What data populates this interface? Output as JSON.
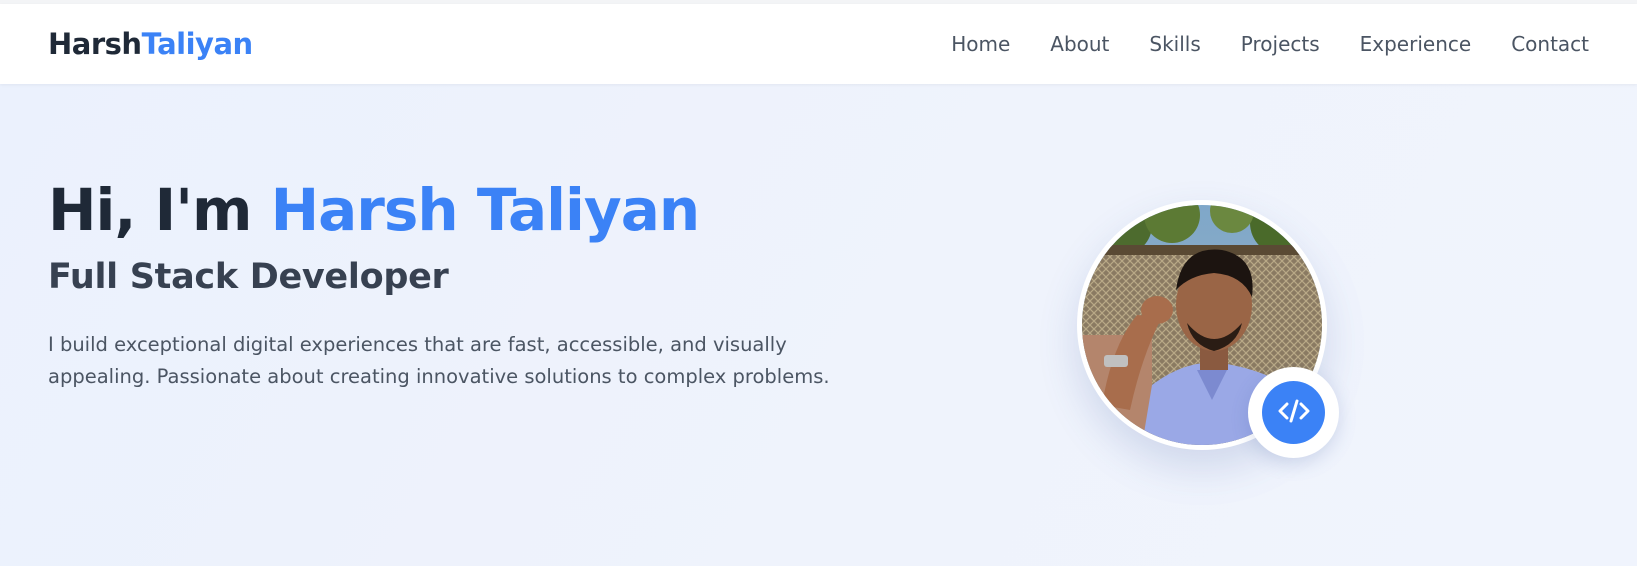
{
  "brand": {
    "first": "Harsh",
    "second": "Taliyan"
  },
  "nav": {
    "items": [
      {
        "label": "Home"
      },
      {
        "label": "About"
      },
      {
        "label": "Skills"
      },
      {
        "label": "Projects"
      },
      {
        "label": "Experience"
      },
      {
        "label": "Contact"
      }
    ]
  },
  "hero": {
    "greeting": "Hi, I'm ",
    "name": "Harsh Taliyan",
    "role": "Full Stack Developer",
    "description": "I build exceptional digital experiences that are fast, accessible, and visually appealing. Passionate about creating innovative solutions to complex problems.",
    "photo_icon": "profile-photo",
    "badge_icon": "code-icon"
  },
  "colors": {
    "accent": "#3b82f6",
    "heading": "#1f2937",
    "text": "#4b5563",
    "background": "#eef2fb"
  }
}
